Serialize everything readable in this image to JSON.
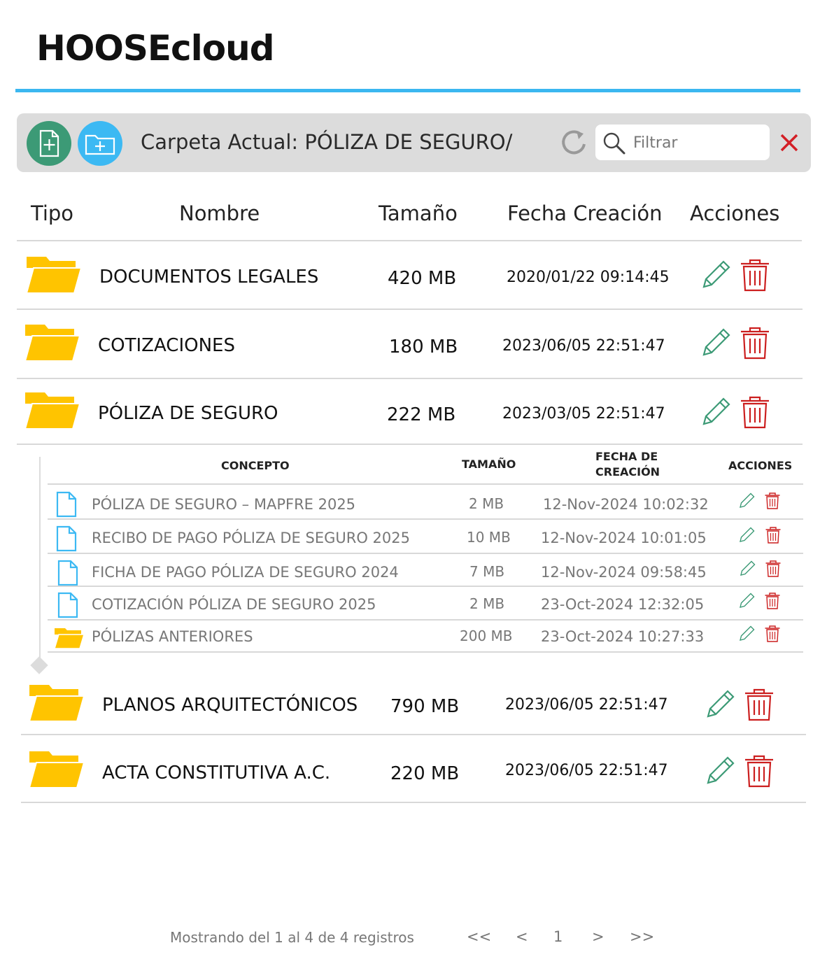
{
  "app": {
    "title": "HOOSEcloud"
  },
  "toolbar": {
    "current_folder": "Carpeta Actual: PÓLIZA DE SEGURO/",
    "filter_placeholder": "Filtrar"
  },
  "table": {
    "headers": {
      "type": "Tipo",
      "name": "Nombre",
      "size": "Tamaño",
      "created": "Fecha Creación",
      "actions": "Acciones"
    },
    "rows": [
      {
        "name": "DOCUMENTOS LEGALES",
        "size": "420 MB",
        "created": "2020/01/22 09:14:45"
      },
      {
        "name": "COTIZACIONES",
        "size": "180 MB",
        "created": "2023/06/05 22:51:47"
      },
      {
        "name": "PÓLIZA DE SEGURO",
        "size": "222 MB",
        "created": "2023/03/05 22:51:47"
      },
      {
        "name": "PLANOS ARQUITECTÓNICOS",
        "size": "790 MB",
        "created": "2023/06/05 22:51:47"
      },
      {
        "name": "ACTA CONSTITUTIVA A.C.",
        "size": "220 MB",
        "created": "2023/06/05 22:51:47"
      }
    ]
  },
  "subtable": {
    "headers": {
      "concept": "CONCEPTO",
      "size": "TAMAÑO",
      "created_line1": "FECHA DE",
      "created_line2": "CREACIÓN",
      "actions": "ACCIONES"
    },
    "rows": [
      {
        "icon": "file-icon",
        "name": "PÓLIZA DE SEGURO – MAPFRE 2025",
        "size": "2 MB",
        "created": "12-Nov-2024 10:02:32"
      },
      {
        "icon": "file-icon",
        "name": "RECIBO DE PAGO PÓLIZA DE SEGURO 2025",
        "size": "10 MB",
        "created": "12-Nov-2024 10:01:05"
      },
      {
        "icon": "file-icon",
        "name": "FICHA DE PAGO PÓLIZA DE SEGURO 2024",
        "size": "7 MB",
        "created": "12-Nov-2024 09:58:45"
      },
      {
        "icon": "file-icon",
        "name": "COTIZACIÓN PÓLIZA DE SEGURO 2025",
        "size": "2 MB",
        "created": "23-Oct-2024 12:32:05"
      },
      {
        "icon": "folder-icon",
        "name": "PÓLIZAS ANTERIORES",
        "size": "200 MB",
        "created": "23-Oct-2024 10:27:33"
      }
    ]
  },
  "pagination": {
    "info": "Mostrando del 1 al 4 de 4 registros",
    "first": "<<",
    "prev": "<",
    "page": "1",
    "next": ">",
    "last": ">>"
  },
  "colors": {
    "accent": "#3bb7f0",
    "new_file_button": "#3c9a76",
    "new_folder_button": "#3cb9f3",
    "folder": "#ffc400",
    "edit": "#3c9a76",
    "delete": "#cc1f1f"
  }
}
